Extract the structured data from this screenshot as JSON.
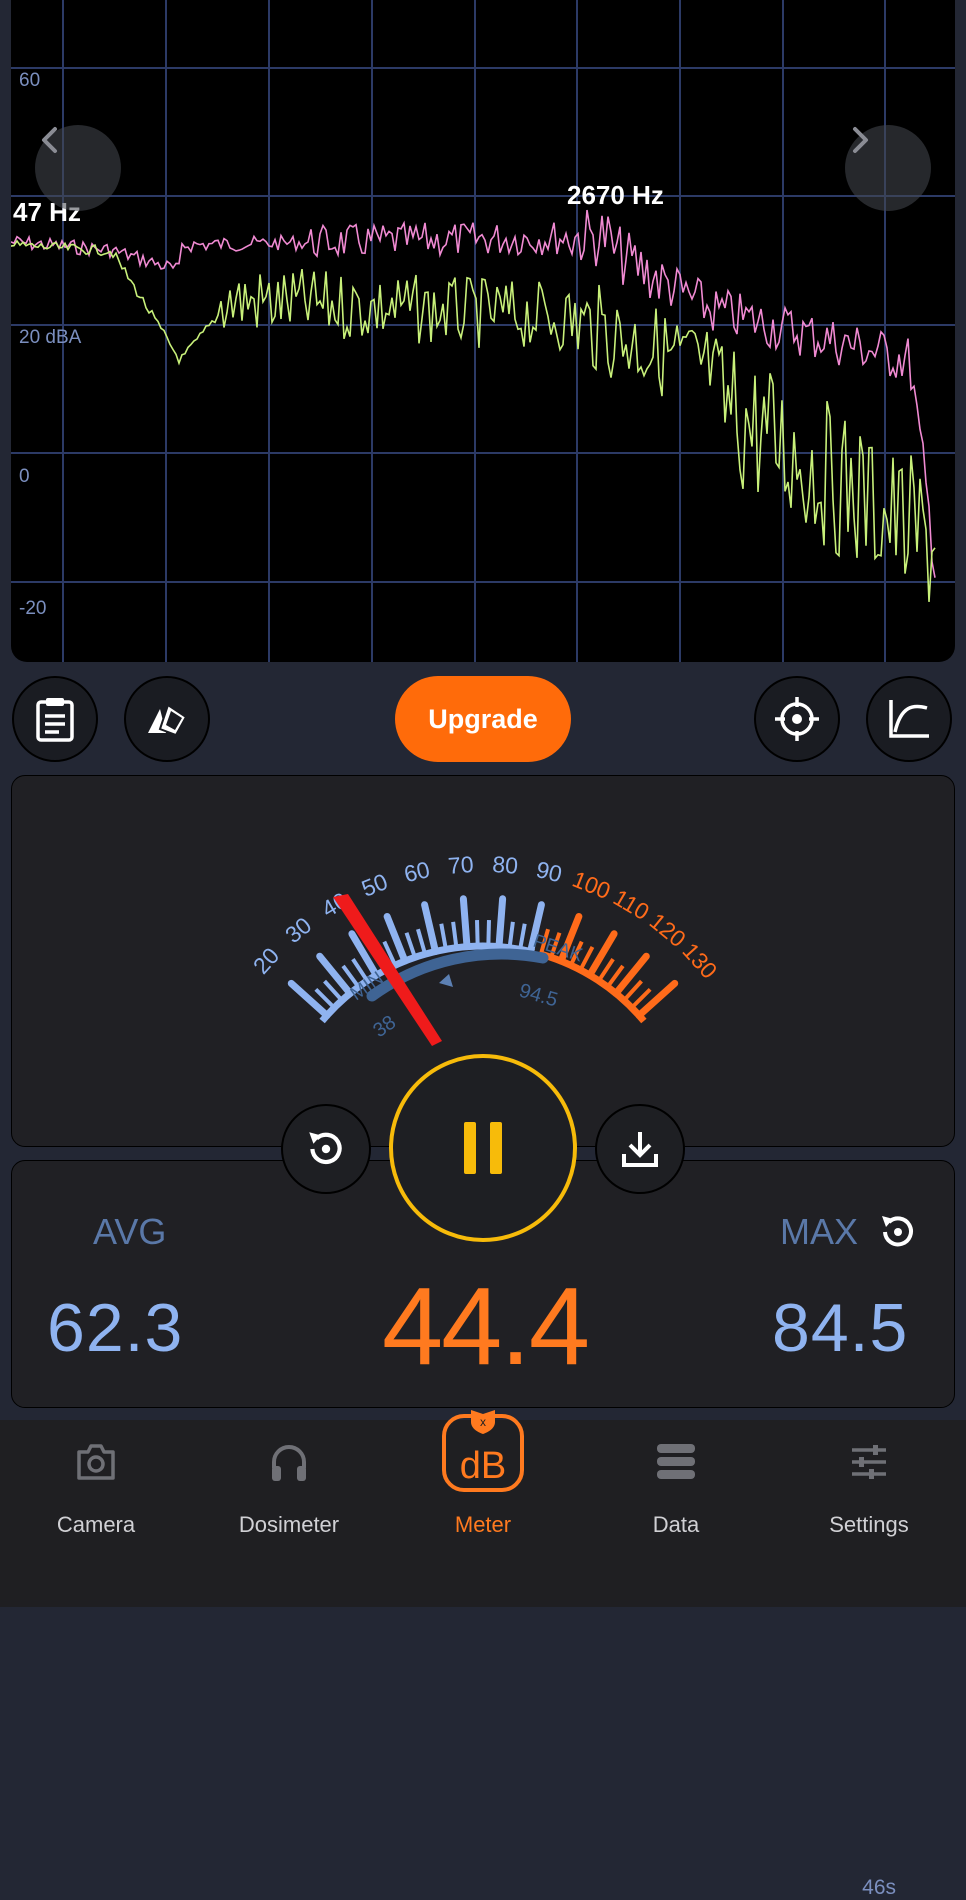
{
  "spectrum": {
    "y_labels": [
      "60",
      "20 dBA",
      "0",
      "-20"
    ],
    "left_label": "47 Hz",
    "peak_label": "2670 Hz",
    "prev_icon": "chevron-left-icon",
    "next_icon": "chevron-right-icon",
    "colors": {
      "peak_trace": "#f08ad2",
      "live_trace": "#c8f07a",
      "grid": "#2c3a66"
    }
  },
  "toolbar": {
    "upgrade_label": "Upgrade",
    "icons": [
      "clipboard-icon",
      "cards-icon",
      "crosshair-icon",
      "chart-icon"
    ]
  },
  "gauge": {
    "ticks": [
      "20",
      "30",
      "40",
      "50",
      "60",
      "70",
      "80",
      "90",
      "100",
      "110",
      "120",
      "130"
    ],
    "min_label": "MIN",
    "peak_label": "PEAK",
    "min_value": "38",
    "peak_value": "94.5",
    "elapsed": "46s"
  },
  "readings": {
    "avg_label": "AVG",
    "avg_value": "62.3",
    "current_value": "44.4",
    "max_label": "MAX",
    "max_value": "84.5"
  },
  "tabs": [
    {
      "label": "Camera",
      "icon": "camera-icon"
    },
    {
      "label": "Dosimeter",
      "icon": "headphones-icon"
    },
    {
      "label": "Meter",
      "icon": "db-meter-icon",
      "active": true
    },
    {
      "label": "Data",
      "icon": "database-icon"
    },
    {
      "label": "Settings",
      "icon": "sliders-icon"
    }
  ],
  "accent": "#ff7a1f",
  "play_ring": "#f7bb0a"
}
